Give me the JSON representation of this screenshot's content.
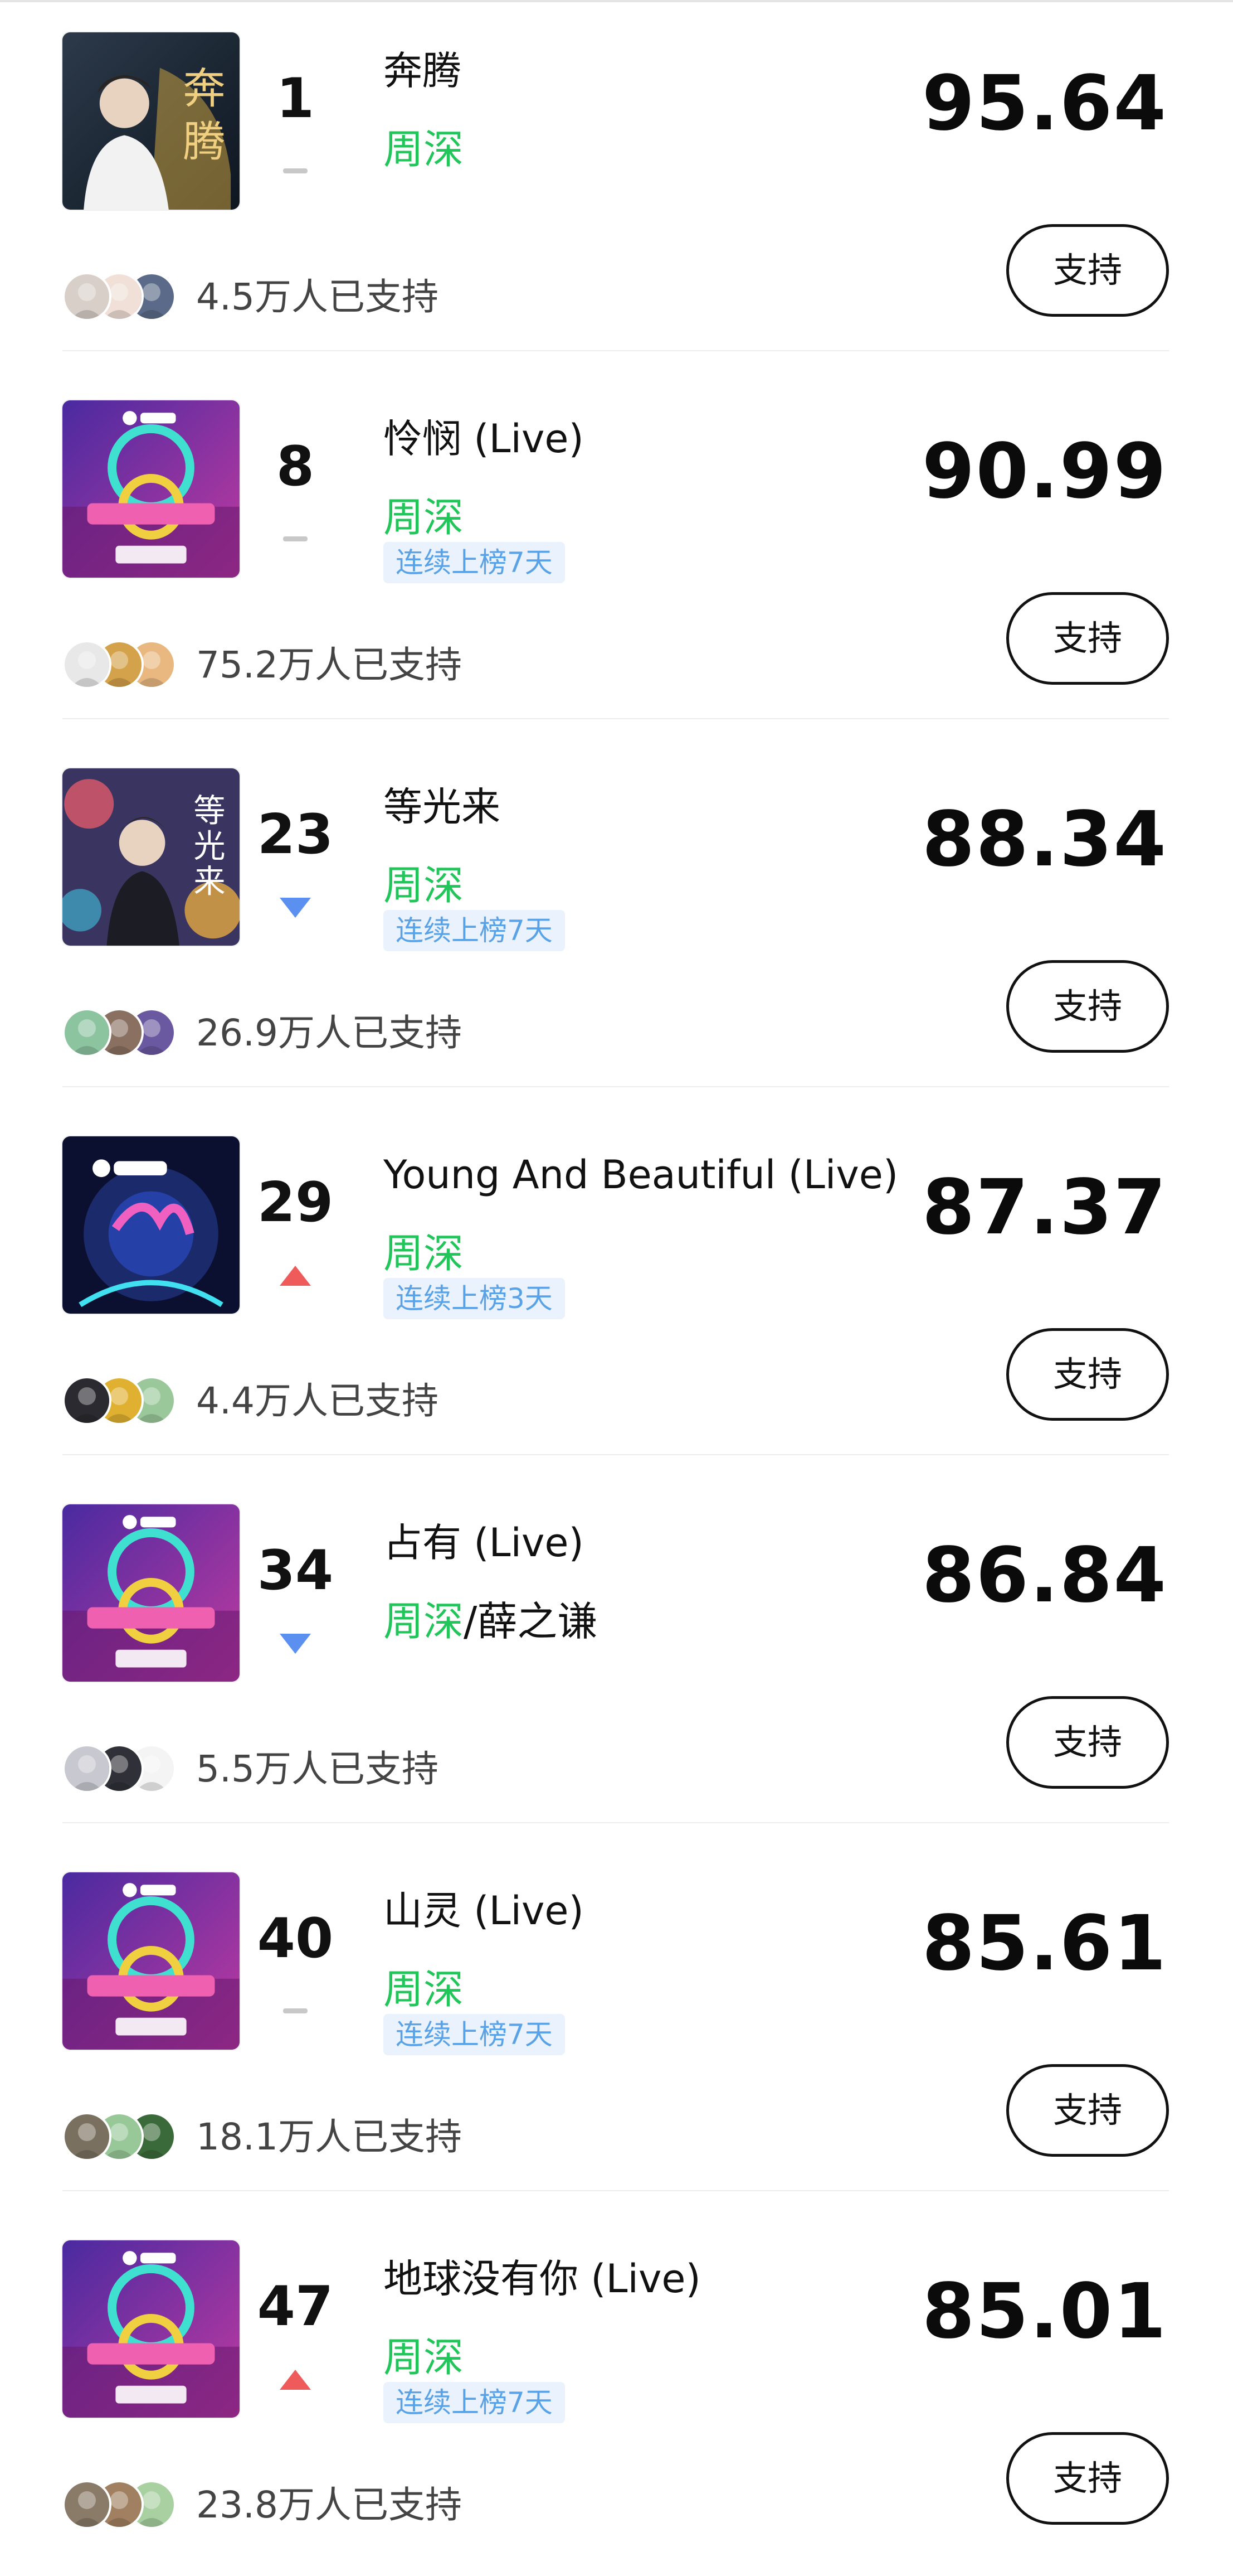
{
  "items": [
    {
      "rank": "1",
      "trend": "same",
      "title": "奔腾",
      "artist": "周深",
      "artist_extra": "",
      "streak": "",
      "score": "95.64",
      "supporters": "4.5万人已支持",
      "support_label": "支持",
      "cover_theme": "portrait-gold",
      "avatar_colors": [
        "#d8cfc8",
        "#f0e0d8",
        "#5a6a88"
      ]
    },
    {
      "rank": "8",
      "trend": "same",
      "title": "怜悯 (Live)",
      "artist": "周深",
      "artist_extra": "",
      "streak": "连续上榜7天",
      "score": "90.99",
      "supporters": "75.2万人已支持",
      "support_label": "支持",
      "cover_theme": "show-purple",
      "avatar_colors": [
        "#e8e8e8",
        "#d4a24a",
        "#e8b880"
      ]
    },
    {
      "rank": "23",
      "trend": "down",
      "title": "等光来",
      "artist": "周深",
      "artist_extra": "",
      "streak": "连续上榜7天",
      "score": "88.34",
      "supporters": "26.9万人已支持",
      "support_label": "支持",
      "cover_theme": "portrait-colorful",
      "avatar_colors": [
        "#8cc4a0",
        "#8a7060",
        "#6a58a0"
      ]
    },
    {
      "rank": "29",
      "trend": "up",
      "title": "Young And Beautiful (Live)",
      "artist": "周深",
      "artist_extra": "",
      "streak": "连续上榜3天",
      "score": "87.37",
      "supporters": "4.4万人已支持",
      "support_label": "支持",
      "cover_theme": "concert-blue",
      "avatar_colors": [
        "#2a2a30",
        "#e0b030",
        "#9ac89a"
      ]
    },
    {
      "rank": "34",
      "trend": "down",
      "title": "占有 (Live)",
      "artist": "周深",
      "artist_extra": "/薛之谦",
      "streak": "",
      "score": "86.84",
      "supporters": "5.5万人已支持",
      "support_label": "支持",
      "cover_theme": "show-purple",
      "avatar_colors": [
        "#c8c8d0",
        "#303038",
        "#f4f4f4"
      ]
    },
    {
      "rank": "40",
      "trend": "same",
      "title": "山灵 (Live)",
      "artist": "周深",
      "artist_extra": "",
      "streak": "连续上榜7天",
      "score": "85.61",
      "supporters": "18.1万人已支持",
      "support_label": "支持",
      "cover_theme": "show-purple",
      "avatar_colors": [
        "#7a7060",
        "#98c898",
        "#3a6a3a"
      ]
    },
    {
      "rank": "47",
      "trend": "up",
      "title": "地球没有你 (Live)",
      "artist": "周深",
      "artist_extra": "",
      "streak": "连续上榜7天",
      "score": "85.01",
      "supporters": "23.8万人已支持",
      "support_label": "支持",
      "cover_theme": "show-purple",
      "avatar_colors": [
        "#8a7a68",
        "#a08060",
        "#a8d0a0"
      ]
    }
  ],
  "colors": {
    "artist_green": "#22c55a",
    "streak_text": "#5aa2e6",
    "streak_bg": "#eaf3fd",
    "trend_up": "#ef5a5a",
    "trend_down": "#5b8ff0",
    "trend_same": "#c8c8c8"
  }
}
